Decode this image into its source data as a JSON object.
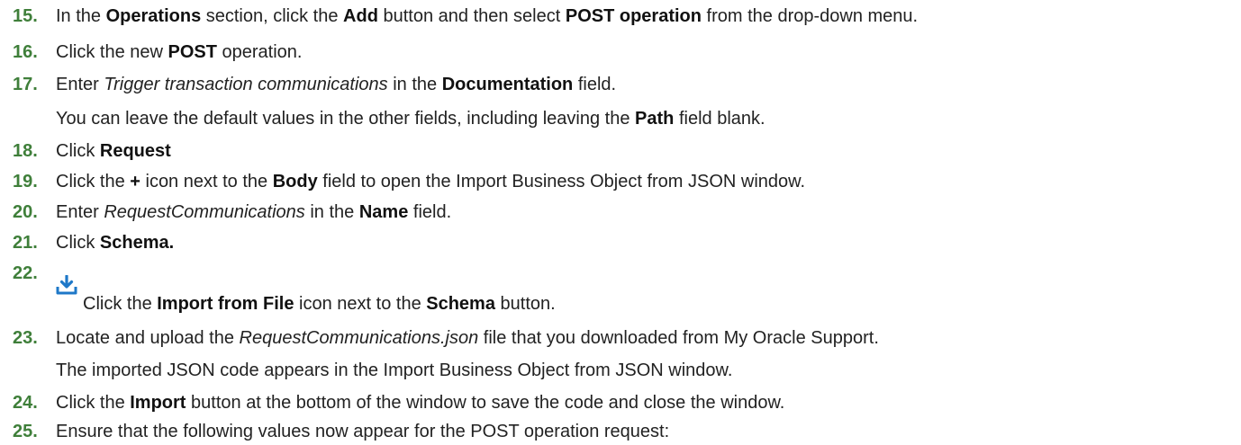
{
  "steps": [
    {
      "number": "15.",
      "parts": [
        {
          "t": "In the "
        },
        {
          "t": "Operations",
          "b": true
        },
        {
          "t": " section, click the "
        },
        {
          "t": "Add",
          "b": true
        },
        {
          "t": " button and then select "
        },
        {
          "t": "POST operation",
          "b": true
        },
        {
          "t": " from the drop-down menu."
        }
      ]
    },
    {
      "number": "16.",
      "parts": [
        {
          "t": "Click the new "
        },
        {
          "t": "POST",
          "b": true
        },
        {
          "t": " operation."
        }
      ]
    },
    {
      "number": "17.",
      "parts": [
        {
          "t": "Enter "
        },
        {
          "t": "Trigger transaction communications",
          "i": true
        },
        {
          "t": " in the "
        },
        {
          "t": "Documentation",
          "b": true
        },
        {
          "t": " field."
        }
      ]
    },
    {
      "number": "",
      "parts": [
        {
          "t": "You can leave the default values in the other fields, including leaving the "
        },
        {
          "t": "Path",
          "b": true
        },
        {
          "t": " field blank."
        }
      ]
    },
    {
      "number": "18.",
      "parts": [
        {
          "t": "Click "
        },
        {
          "t": "Request",
          "b": true
        }
      ]
    },
    {
      "number": "19.",
      "parts": [
        {
          "t": "Click the "
        },
        {
          "t": "+",
          "b": true
        },
        {
          "t": " icon next to the "
        },
        {
          "t": "Body",
          "b": true
        },
        {
          "t": " field to open the Import Business Object from JSON window."
        }
      ]
    },
    {
      "number": "20.",
      "parts": [
        {
          "t": "Enter "
        },
        {
          "t": "RequestCommunications",
          "i": true
        },
        {
          "t": " in the "
        },
        {
          "t": "Name",
          "b": true
        },
        {
          "t": " field."
        }
      ]
    },
    {
      "number": "21.",
      "parts": [
        {
          "t": "Click "
        },
        {
          "t": "Schema.",
          "b": true
        }
      ]
    },
    {
      "number": "22.",
      "icon": "import-from-file-icon",
      "parts": [
        {
          "t": "Click the "
        },
        {
          "t": "Import from File",
          "b": true
        },
        {
          "t": " icon next to the "
        },
        {
          "t": "Schema",
          "b": true
        },
        {
          "t": " button."
        }
      ]
    },
    {
      "number": "23.",
      "parts": [
        {
          "t": "Locate and upload the "
        },
        {
          "t": "RequestCommunications.json",
          "i": true
        },
        {
          "t": " file that you downloaded from My Oracle Support."
        }
      ]
    },
    {
      "number": "",
      "parts": [
        {
          "t": "The imported JSON code appears in the Import Business Object from JSON window."
        }
      ]
    },
    {
      "number": "24.",
      "parts": [
        {
          "t": "Click the "
        },
        {
          "t": "Import",
          "b": true
        },
        {
          "t": " button at the bottom of the window to save the code and close the window."
        }
      ]
    },
    {
      "number": "25.",
      "parts": [
        {
          "t": "Ensure that the following values now appear for the POST operation request:"
        }
      ]
    }
  ],
  "colors": {
    "step_number": "#3f7f3a",
    "icon": "#1e78c8"
  }
}
